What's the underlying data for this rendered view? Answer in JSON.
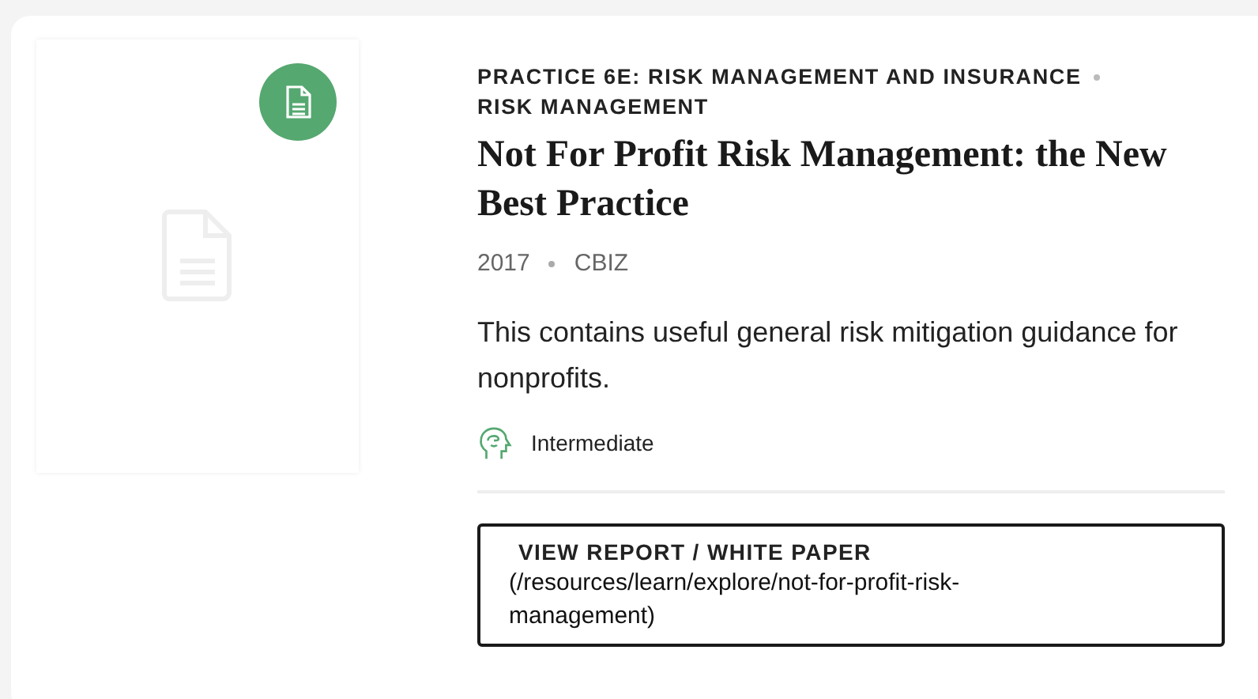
{
  "categories": [
    "PRACTICE 6E: RISK MANAGEMENT AND INSURANCE",
    "RISK MANAGEMENT"
  ],
  "title": "Not For Profit Risk Management: the New Best Practice",
  "meta": [
    "2017",
    "CBIZ"
  ],
  "description": "This contains useful general risk mitigation guidance for nonprofits.",
  "level": {
    "label": "Intermediate"
  },
  "link": {
    "label": "VIEW REPORT / WHITE PAPER",
    "url": "(/resources/learn/explore/not-for-profit-risk-management)"
  }
}
